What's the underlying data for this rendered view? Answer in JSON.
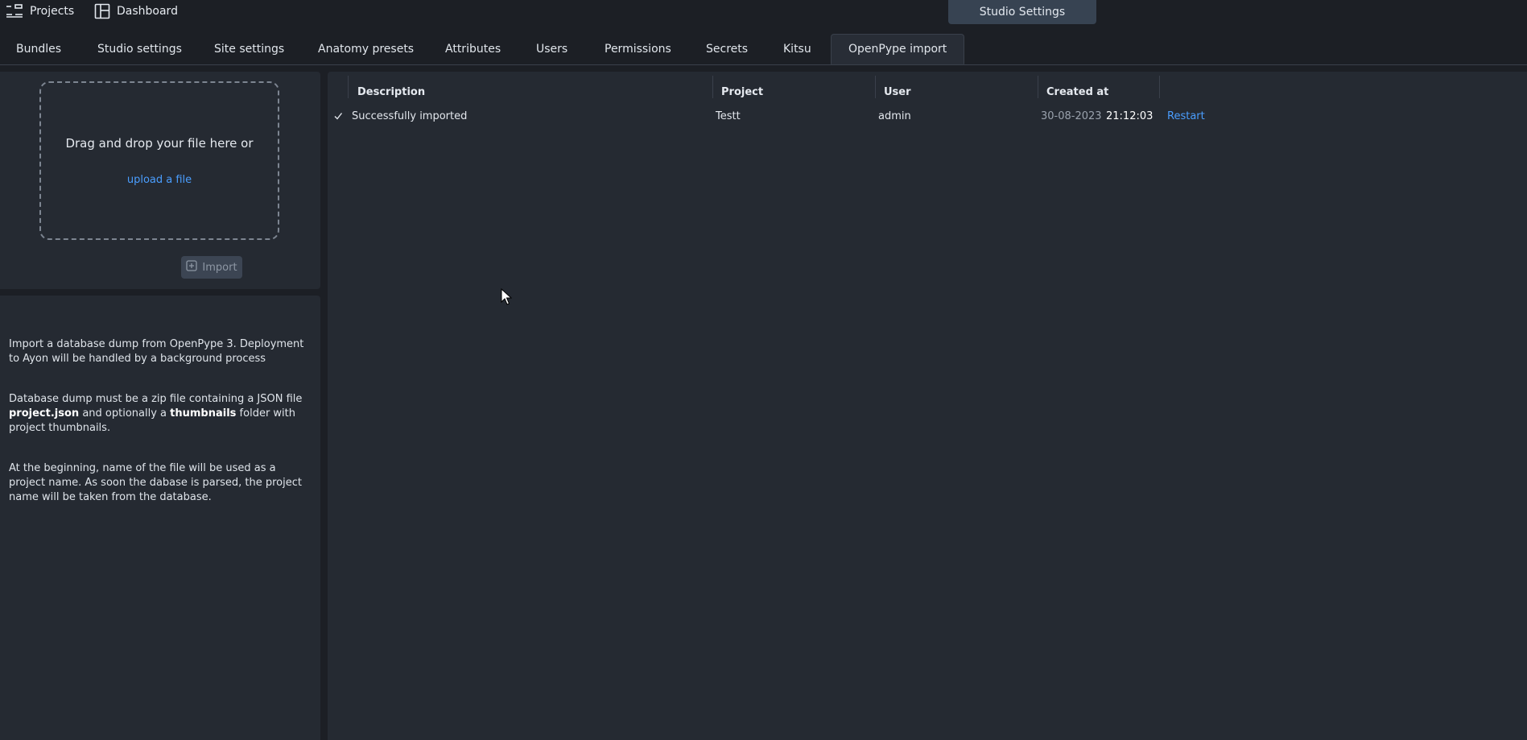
{
  "topbar": {
    "projects_label": "Projects",
    "dashboard_label": "Dashboard",
    "studio_settings_label": "Studio Settings"
  },
  "tabs": [
    {
      "label": "Bundles"
    },
    {
      "label": "Studio settings"
    },
    {
      "label": "Site settings"
    },
    {
      "label": "Anatomy presets"
    },
    {
      "label": "Attributes"
    },
    {
      "label": "Users"
    },
    {
      "label": "Permissions"
    },
    {
      "label": "Secrets"
    },
    {
      "label": "Kitsu"
    },
    {
      "label": "OpenPype import",
      "active": true
    }
  ],
  "upload": {
    "drop_text": "Drag and drop your file here or",
    "link_text": "upload a file",
    "import_label": "Import"
  },
  "help": {
    "p1": "Import a database dump from OpenPype 3. Deployment to Ayon will be handled by a background process",
    "p2_a": "Database dump must be a zip file containing a JSON file",
    "p2_b": "project.json",
    "p2_c": "and optionally a",
    "p2_d": "thumbnails",
    "p2_e": "folder with project thumbnails.",
    "p3": "At the beginning, name of the file will be used as a project name. As soon the dabase is parsed, the project name will be taken from the database."
  },
  "table": {
    "columns": [
      "Description",
      "Project",
      "User",
      "Created at"
    ],
    "rows": [
      {
        "status_icon": "check-icon",
        "description": "Successfully imported",
        "project": "Testt",
        "user": "admin",
        "date": "30-08-2023",
        "time": "21:12:03",
        "action": "Restart"
      }
    ]
  },
  "colors": {
    "background": "#1c1f25",
    "panel": "#252a32",
    "accent_link": "#4a9eff",
    "studio_button": "#374352"
  }
}
